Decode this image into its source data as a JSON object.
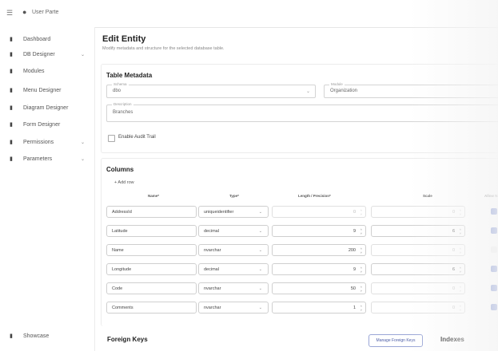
{
  "header": {
    "user_name": "User Parte",
    "menu_icon": "hamburger-icon",
    "user_icon": "person-icon"
  },
  "sidebar": {
    "items": [
      {
        "label": "Dashboard",
        "icon": "doc-icon",
        "chevron": ""
      },
      {
        "label": "DB Designer",
        "icon": "doc-icon",
        "chevron": "⌄"
      },
      {
        "label": "Modules",
        "icon": "doc-icon",
        "chevron": ""
      },
      {
        "label": "Menu Designer",
        "icon": "doc-icon",
        "chevron": ""
      },
      {
        "label": "Diagram Designer",
        "icon": "doc-icon",
        "chevron": ""
      },
      {
        "label": "Form Designer",
        "icon": "doc-icon",
        "chevron": ""
      },
      {
        "label": "Permissions",
        "icon": "doc-icon",
        "chevron": "⌄"
      },
      {
        "label": "Parameters",
        "icon": "doc-icon",
        "chevron": "⌄"
      }
    ],
    "footer_item": {
      "label": "Showcase",
      "icon": "doc-icon"
    }
  },
  "page": {
    "title": "Edit Entity",
    "subtitle": "Modify metadata and structure for the selected database table."
  },
  "metadata": {
    "title": "Table Metadata",
    "schema_label": "Schema",
    "schema_value": "dbo",
    "module_label": "Module",
    "module_value": "Organization",
    "description_label": "Description",
    "description_value": "Branches",
    "audit_label": "Enable Audit Trail"
  },
  "columns": {
    "title": "Columns",
    "add_row_label": "+  Add row",
    "headers": {
      "name": "Name*",
      "type": "Type*",
      "length": "Length / Precision*",
      "scale": "Scale",
      "allow": "Allow N"
    },
    "rows": [
      {
        "name": "AddressId",
        "type": "uniqueidentifier",
        "length": "0",
        "scale": "0",
        "length_disabled": true,
        "scale_disabled": true,
        "allow_null": true
      },
      {
        "name": "Latitude",
        "type": "decimal",
        "length": "9",
        "scale": "6",
        "length_disabled": false,
        "scale_disabled": false,
        "allow_null": true
      },
      {
        "name": "Name",
        "type": "nvarchar",
        "length": "200",
        "scale": "0",
        "length_disabled": false,
        "scale_disabled": true,
        "allow_null": false
      },
      {
        "name": "Longitude",
        "type": "decimal",
        "length": "9",
        "scale": "6",
        "length_disabled": false,
        "scale_disabled": false,
        "allow_null": true
      },
      {
        "name": "Code",
        "type": "nvarchar",
        "length": "50",
        "scale": "0",
        "length_disabled": false,
        "scale_disabled": true,
        "allow_null": true
      },
      {
        "name": "Comments",
        "type": "nvarchar",
        "length": "1",
        "scale": "0",
        "length_disabled": false,
        "scale_disabled": true,
        "allow_null": true
      }
    ]
  },
  "footer": {
    "foreign_keys_title": "Foreign Keys",
    "manage_fk_label": "Manage Foreign Keys",
    "indexes_title": "Indexes"
  },
  "colors": {
    "accent": "#3f51b5",
    "checkbox_on": "#2f4fb7",
    "checkbox_off": "#e4e4e4"
  }
}
